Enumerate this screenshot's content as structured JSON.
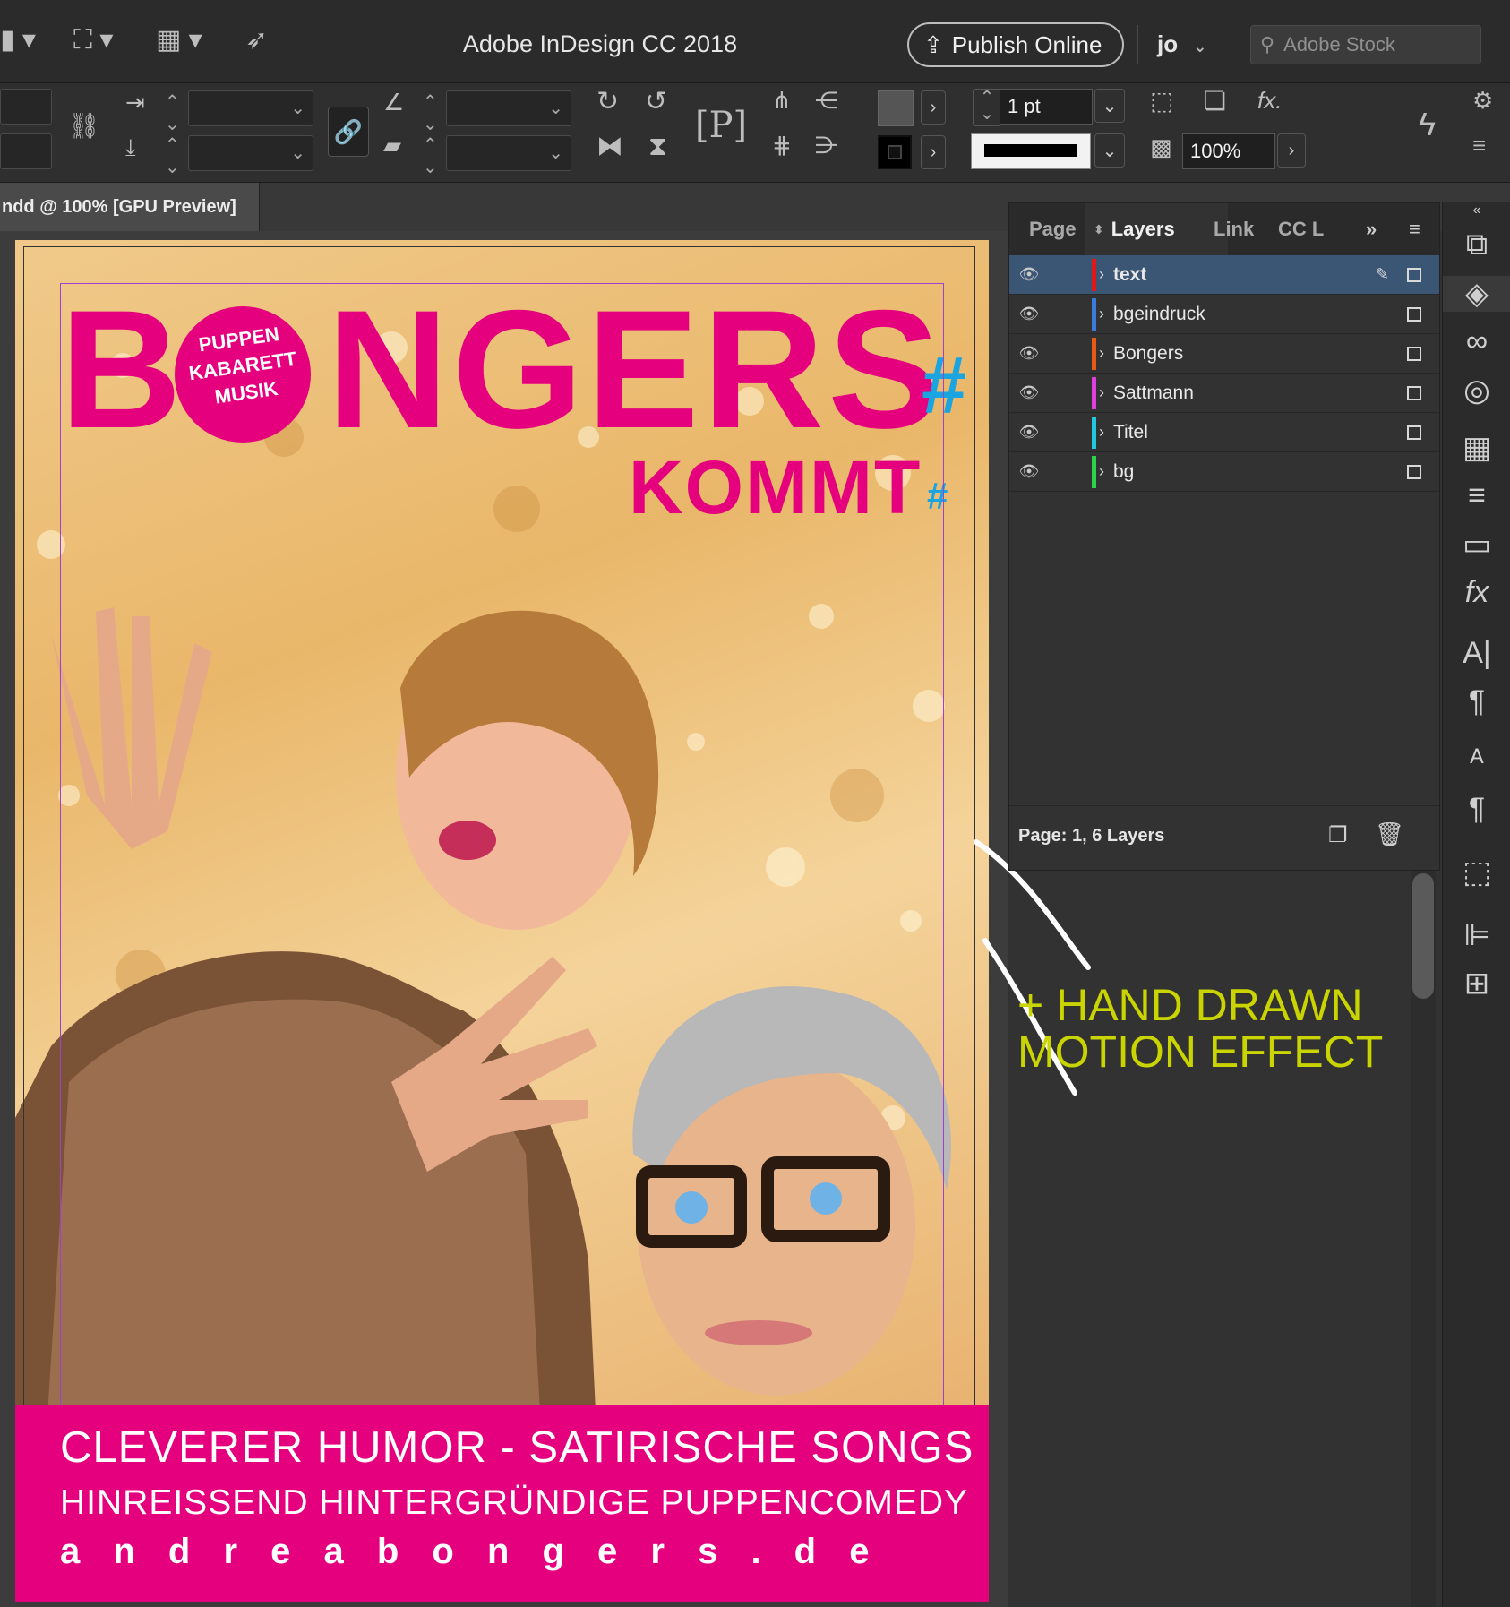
{
  "app": {
    "title": "Adobe InDesign CC 2018",
    "publish_label": "Publish Online",
    "user_initials": "jo",
    "stock_search_placeholder": "Adobe Stock"
  },
  "control_bar": {
    "stroke_weight": "1 pt",
    "opacity": "100%"
  },
  "document": {
    "tab_label": "ndd @ 100% [GPU Preview]"
  },
  "layers_panel": {
    "tabs": [
      "Page",
      "Layers",
      "Link",
      "CC L"
    ],
    "active_tab": "Layers",
    "layers": [
      {
        "name": "text",
        "color": "#e01818",
        "selected": true
      },
      {
        "name": "bgeindruck",
        "color": "#3a7be0",
        "selected": false
      },
      {
        "name": "Bongers",
        "color": "#e85a13",
        "selected": false
      },
      {
        "name": "Sattmann",
        "color": "#e23ddf",
        "selected": false
      },
      {
        "name": "Titel",
        "color": "#20c8e0",
        "selected": false
      },
      {
        "name": "bg",
        "color": "#2ed14a",
        "selected": false
      }
    ],
    "status": "Page: 1, 6 Layers"
  },
  "poster": {
    "title_b": "B",
    "title_rest": "NGERS",
    "badge_lines": [
      "PUPPEN",
      "KABARETT",
      "MUSIK"
    ],
    "kommt": "KOMMT",
    "bottom_line1": "CLEVERER HUMOR - SATIRISCHE SONGS",
    "bottom_line2": "HINREISSEND HINTERGRÜNDIGE PUPPENCOMEDY",
    "bottom_line3": "a n d r e a b o n g e r s . d e",
    "brand_color": "#e5007e"
  },
  "pasteboard_note": {
    "line1": "+ HAND DRAWN",
    "line2": "MOTION EFFECT",
    "color": "#c9d400"
  }
}
